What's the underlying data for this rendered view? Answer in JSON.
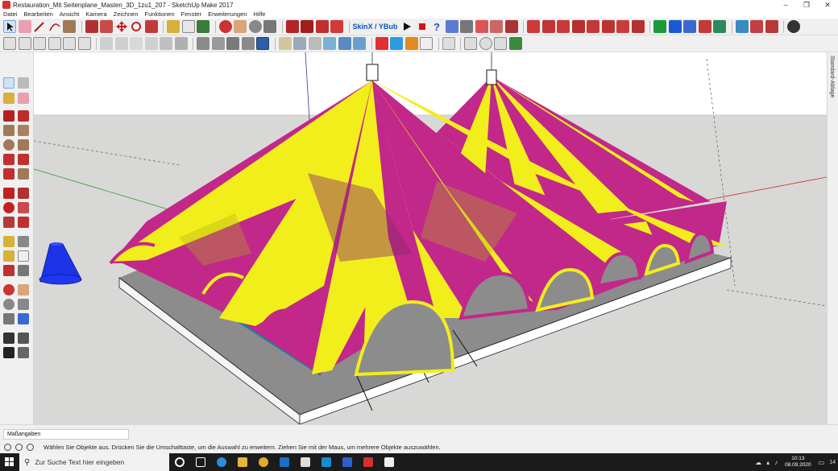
{
  "window": {
    "title": "Restauration_Mit Seitenplane_Masten_3D_1zu1_207 - SketchUp Make 2017",
    "minimize": "–",
    "maximize": "❐",
    "close": "✕"
  },
  "menu": [
    "Datei",
    "Bearbeiten",
    "Ansicht",
    "Kamera",
    "Zeichnen",
    "Funktionen",
    "Fenster",
    "Erweiterungen",
    "Hilfe"
  ],
  "toolbar1": {
    "skinx_label": "SkinX / YBub"
  },
  "tray": {
    "label": "Standard-Ablage"
  },
  "measurements": {
    "label": "Maßangaben"
  },
  "status": {
    "hint": "Wählen Sie Objekte aus. Drücken Sie die Umschalttaste, um die Auswahl zu erweitern. Ziehen Sie mit der Maus, um mehrere Objekte auszuwählen."
  },
  "taskbar": {
    "search_placeholder": "Zur Suche Text hier eingeben",
    "time": "10:13",
    "date": "08.09.2020",
    "notification_count": "14"
  },
  "colors": {
    "magenta": "#c2278a",
    "yellow": "#f2ee1c",
    "platform": "#8c8c8c",
    "ground": "#d8d8d6",
    "sky": "#ffffff",
    "cone": "#1c33e8"
  }
}
